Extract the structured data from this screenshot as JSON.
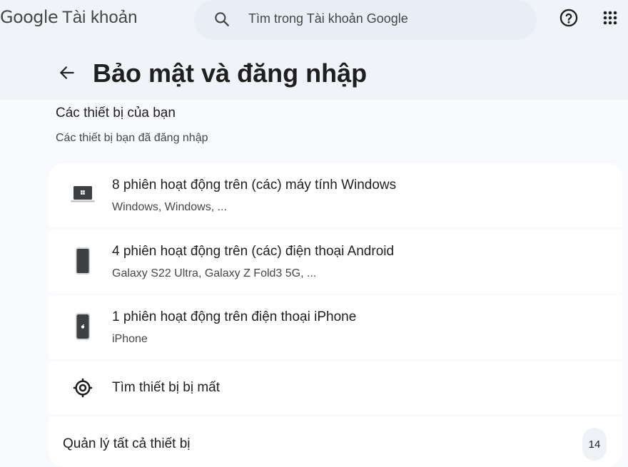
{
  "brand": {
    "google": "Google",
    "product": "Tài khoản"
  },
  "search": {
    "placeholder": "Tìm trong Tài khoản Google"
  },
  "page": {
    "title": "Bảo mật và đăng nhập"
  },
  "section": {
    "title": "Các thiết bị của bạn",
    "subtitle": "Các thiết bị bạn đã đăng nhập"
  },
  "devices": [
    {
      "icon": "laptop-windows-icon",
      "title": "8 phiên hoạt động trên (các) máy tính Windows",
      "subtitle": "Windows, Windows, ..."
    },
    {
      "icon": "android-phone-icon",
      "title": "4 phiên hoạt động trên (các) điện thoại Android",
      "subtitle": "Galaxy S22 Ultra, Galaxy Z Fold3 5G, ..."
    },
    {
      "icon": "iphone-icon",
      "title": "1 phiên hoạt động trên điện thoại iPhone",
      "subtitle": "iPhone"
    }
  ],
  "find_device": {
    "icon": "location-target-icon",
    "label": "Tìm thiết bị bị mất"
  },
  "manage": {
    "label": "Quản lý tất cả thiết bị",
    "count": "14"
  },
  "colors": {
    "background": "#f8fafd",
    "header": "#f0f4f9",
    "search": "#e9eef6",
    "card": "#ffffff",
    "text": "#1f1f1f",
    "secondary_text": "#444746"
  }
}
